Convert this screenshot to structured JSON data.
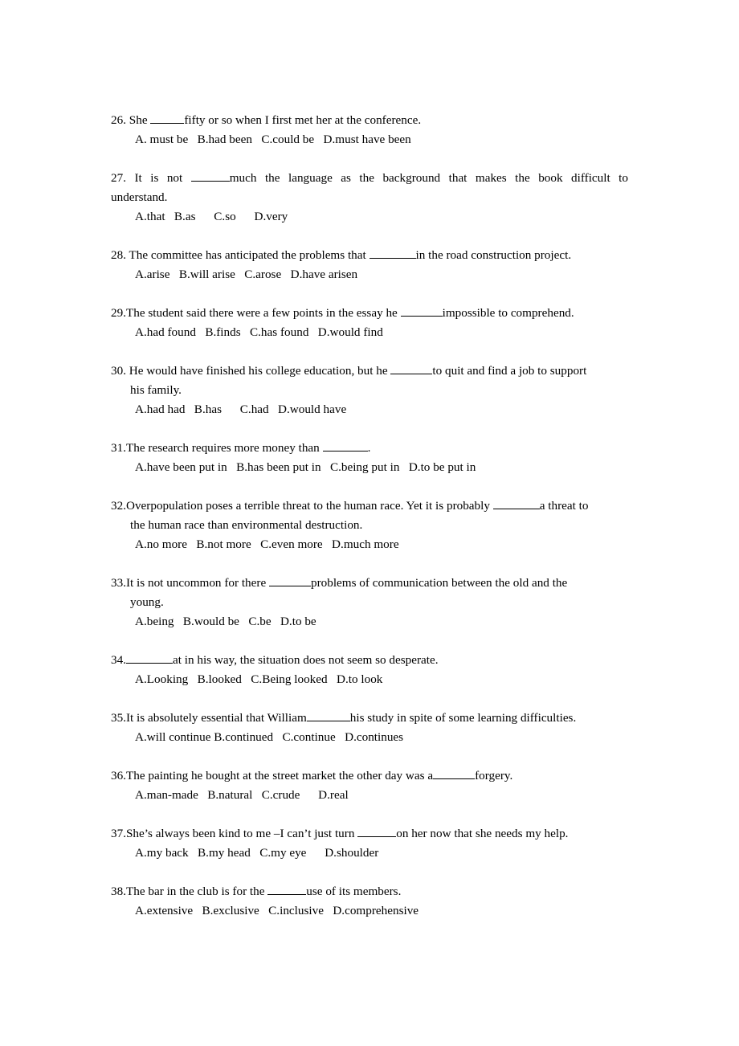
{
  "document": {
    "type": "multiple-choice-grammar-exercise",
    "first_question_number": 26,
    "last_question_number": 38
  },
  "questions": [
    {
      "id": "q26",
      "number": "26.",
      "number_space": " ",
      "lines": [
        {
          "pre": "She ",
          "blank": 42,
          "post": "fifty or so when I first met her at the conference.",
          "align": "left",
          "indent": "none"
        }
      ],
      "options": "A. must be   B.had been   C.could be   D.must have been"
    },
    {
      "id": "q27",
      "number": "27.",
      "number_space": " ",
      "lines": [
        {
          "pre": "It is not ",
          "blank": 48,
          "post": "much the language as the background that makes the book difficult to",
          "align": "justify",
          "indent": "none"
        },
        {
          "pre": "understand.",
          "blank": 0,
          "post": "",
          "align": "left",
          "indent": "flush"
        }
      ],
      "options": "A.that   B.as      C.so      D.very"
    },
    {
      "id": "q28",
      "number": "28.",
      "number_space": " ",
      "lines": [
        {
          "pre": "The committee has anticipated the problems that ",
          "blank": 58,
          "post": "in the road construction project.",
          "align": "left",
          "indent": "none"
        }
      ],
      "options": "A.arise   B.will arise   C.arose   D.have arisen"
    },
    {
      "id": "q29",
      "number": "29.",
      "number_space": "",
      "lines": [
        {
          "pre": "The student said there were a few points in the essay he ",
          "blank": 52,
          "post": "impossible to comprehend.",
          "align": "left",
          "indent": "none"
        }
      ],
      "options": "A.had found   B.finds   C.has found   D.would find"
    },
    {
      "id": "q30",
      "number": "30.",
      "number_space": " ",
      "lines": [
        {
          "pre": "He would have finished his college education, but he ",
          "blank": 52,
          "post": "to quit and find a job to support",
          "align": "left",
          "indent": "none"
        },
        {
          "pre": "his family.",
          "blank": 0,
          "post": "",
          "align": "left",
          "indent": "hanging"
        }
      ],
      "options": "A.had had   B.has      C.had   D.would have"
    },
    {
      "id": "q31",
      "number": "31.",
      "number_space": "",
      "lines": [
        {
          "pre": "The research requires more money than ",
          "blank": 56,
          "post": ".",
          "align": "left",
          "indent": "none"
        }
      ],
      "options": "A.have been put in   B.has been put in   C.being put in   D.to be put in"
    },
    {
      "id": "q32",
      "number": "32.",
      "number_space": "",
      "lines": [
        {
          "pre": "Overpopulation poses a terrible threat to the human race. Yet it is probably ",
          "blank": 58,
          "post": "a threat to",
          "align": "left",
          "indent": "none"
        },
        {
          "pre": "the human race than environmental destruction.",
          "blank": 0,
          "post": "",
          "align": "left",
          "indent": "hanging"
        }
      ],
      "options": "A.no more   B.not more   C.even more   D.much more"
    },
    {
      "id": "q33",
      "number": "33.",
      "number_space": "",
      "lines": [
        {
          "pre": "It is not uncommon for there ",
          "blank": 52,
          "post": "problems of communication between the old and the",
          "align": "left",
          "indent": "none"
        },
        {
          "pre": "young.",
          "blank": 0,
          "post": "",
          "align": "left",
          "indent": "hanging"
        }
      ],
      "options": "A.being   B.would be   C.be   D.to be"
    },
    {
      "id": "q34",
      "number": "34.",
      "number_space": "",
      "lines": [
        {
          "pre": "",
          "blank": 58,
          "post": "at in his way, the situation does not seem so desperate.",
          "align": "left",
          "indent": "none"
        }
      ],
      "options": "A.Looking   B.looked   C.Being looked   D.to look"
    },
    {
      "id": "q35",
      "number": "35.",
      "number_space": "",
      "lines": [
        {
          "pre": "It is absolutely essential that William",
          "blank": 54,
          "post": "his study in spite of some learning difficulties.",
          "align": "left",
          "indent": "none"
        }
      ],
      "options": "A.will continue B.continued   C.continue   D.continues"
    },
    {
      "id": "q36",
      "number": "36.",
      "number_space": "",
      "lines": [
        {
          "pre": "The painting he bought at the street market the other day was a",
          "blank": 52,
          "post": "forgery.",
          "align": "left",
          "indent": "none"
        }
      ],
      "options": "A.man-made   B.natural   C.crude      D.real"
    },
    {
      "id": "q37",
      "number": "37.",
      "number_space": "",
      "lines": [
        {
          "pre": "She’s always been kind to me –I can’t just turn ",
          "blank": 48,
          "post": "on her now that she needs my help.",
          "align": "left",
          "indent": "none"
        }
      ],
      "options": "A.my back   B.my head   C.my eye      D.shoulder"
    },
    {
      "id": "q38",
      "number": "38.",
      "number_space": "",
      "lines": [
        {
          "pre": "The bar in the club is for the ",
          "blank": 48,
          "post": "use of its members.",
          "align": "left",
          "indent": "none"
        }
      ],
      "options": "A.extensive   B.exclusive   C.inclusive   D.comprehensive"
    }
  ]
}
